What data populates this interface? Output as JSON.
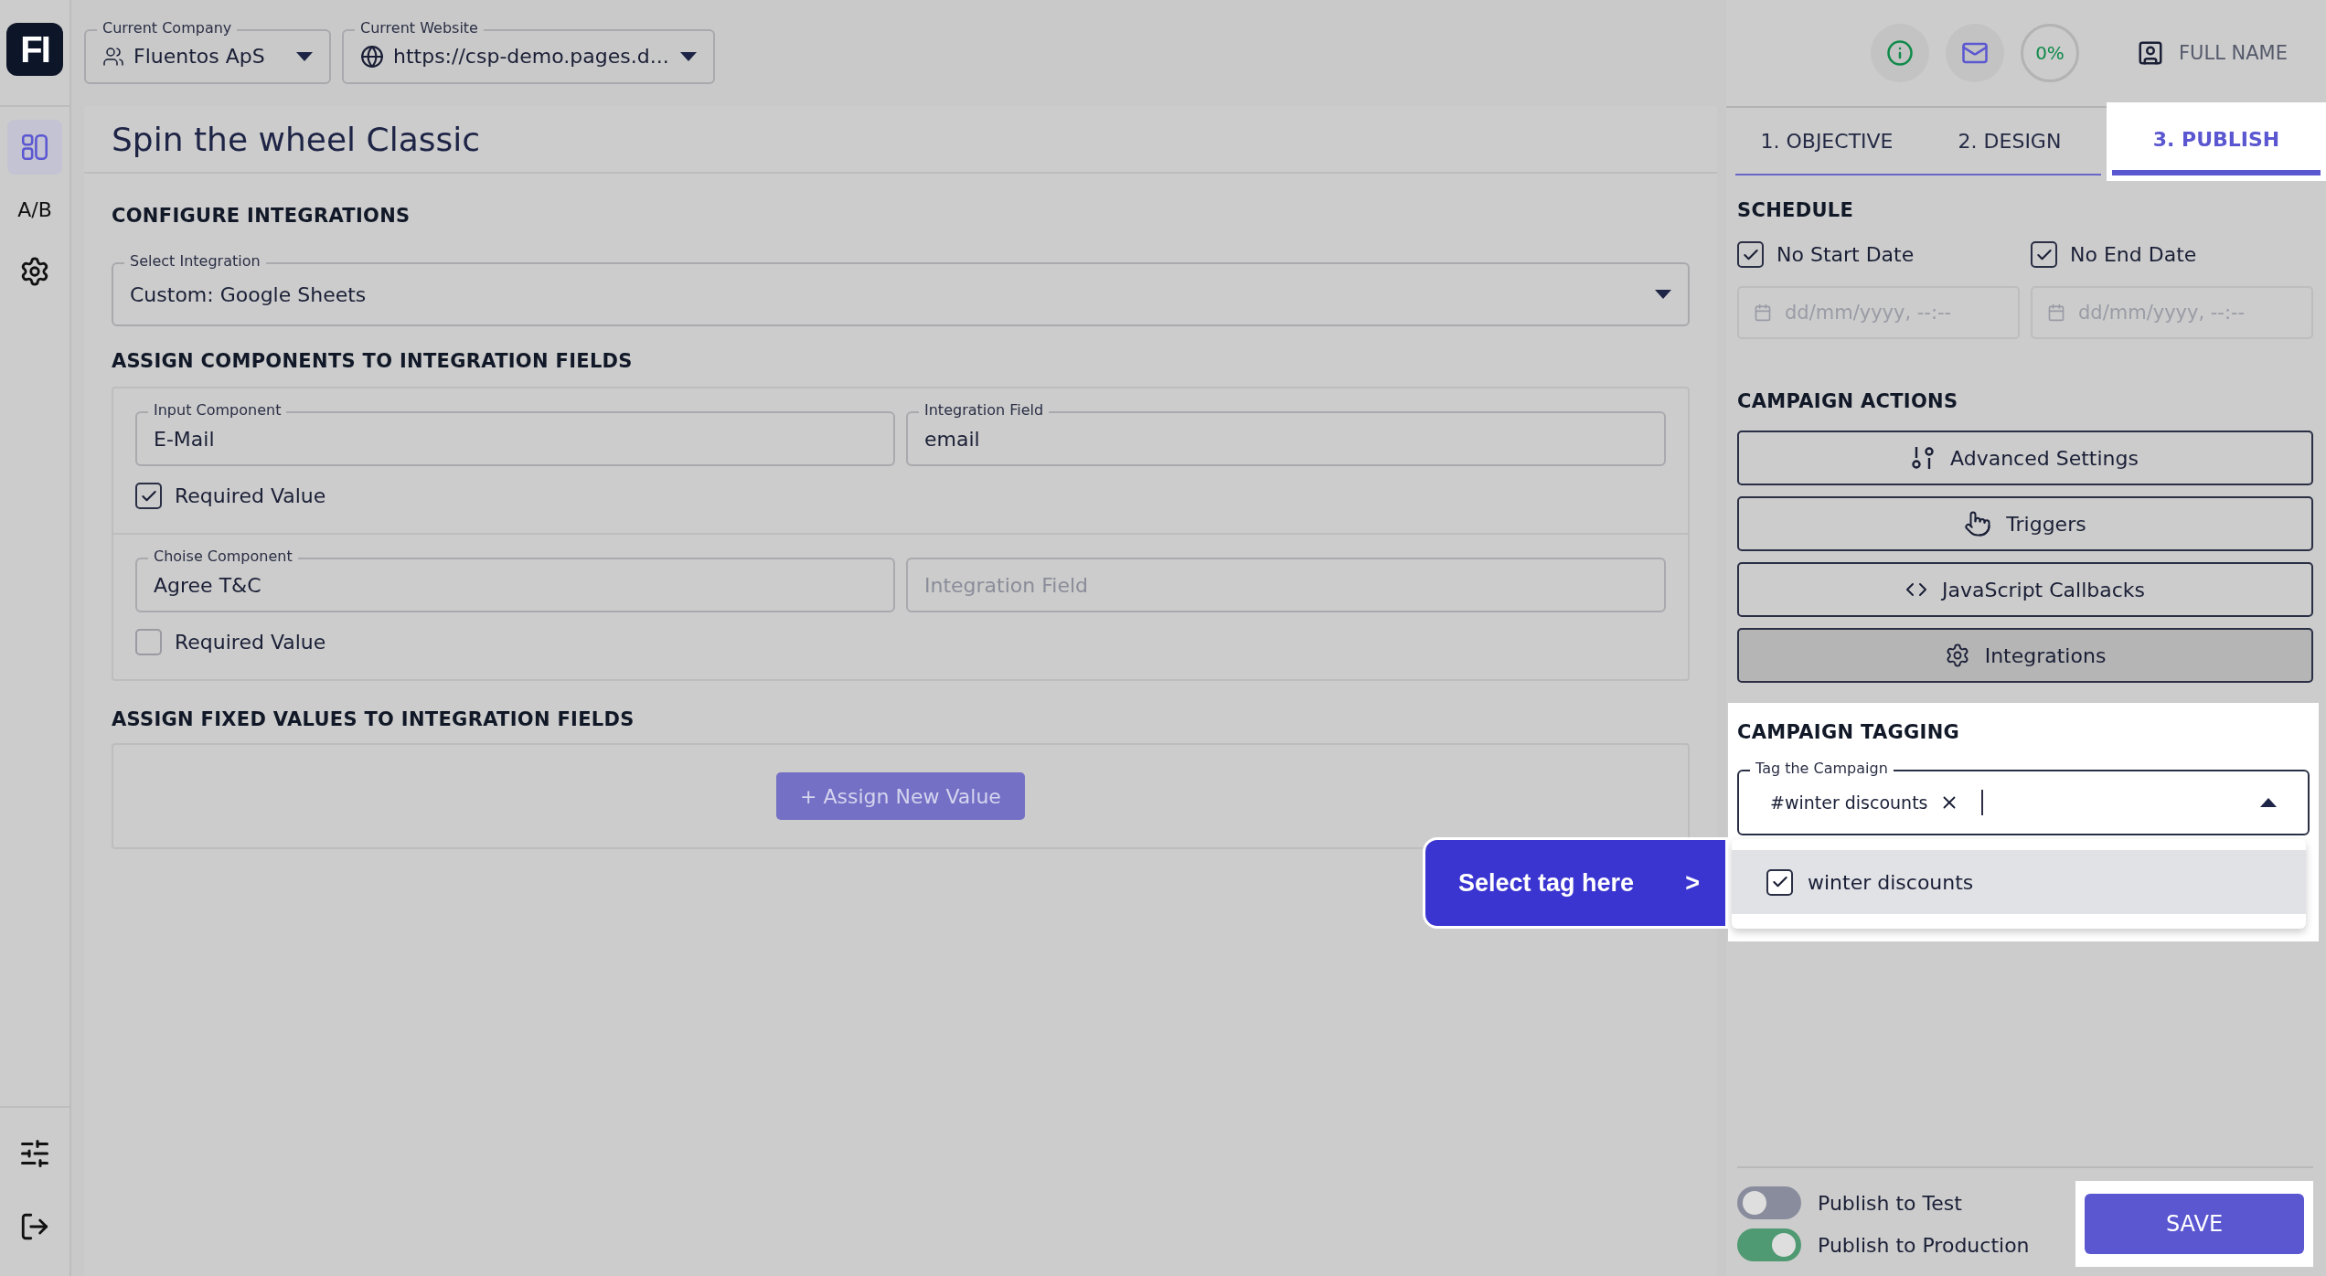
{
  "logo": "FI",
  "sidebar": {
    "items": [
      {
        "kind": "layout",
        "selected": true
      },
      {
        "kind": "text",
        "label": "A/B",
        "selected": false
      },
      {
        "kind": "settings",
        "selected": false
      }
    ],
    "bottom_items": [
      {
        "kind": "sliders"
      },
      {
        "kind": "logout"
      }
    ]
  },
  "header": {
    "company": {
      "label": "Current Company",
      "value": "Fluentos ApS"
    },
    "website": {
      "label": "Current Website",
      "value": "https://csp-demo.pages.d..."
    },
    "progress": "0%",
    "user": "FULL NAME"
  },
  "title": "Spin the wheel Classic",
  "integration": {
    "heading": "CONFIGURE INTEGRATIONS",
    "select": {
      "label": "Select Integration",
      "value": "Custom: Google Sheets"
    }
  },
  "assign": {
    "heading": "ASSIGN COMPONENTS TO INTEGRATION FIELDS",
    "rows": [
      {
        "component": {
          "label": "Input Component",
          "value": "E-Mail"
        },
        "field": {
          "label": "Integration Field",
          "value": "email"
        },
        "required": {
          "label": "Required Value",
          "checked": true
        }
      },
      {
        "component": {
          "label": "Choise Component",
          "value": "Agree T&C"
        },
        "field": {
          "placeholder": "Integration Field"
        },
        "required": {
          "label": "Required Value",
          "checked": false
        }
      }
    ]
  },
  "fixed": {
    "heading": "ASSIGN FIXED VALUES TO INTEGRATION FIELDS",
    "button": "+ Assign New Value"
  },
  "tabs": [
    {
      "label": "1. OBJECTIVE",
      "selected": false
    },
    {
      "label": "2. DESIGN",
      "selected": false
    },
    {
      "label": "3. PUBLISH",
      "selected": true
    }
  ],
  "schedule": {
    "heading": "SCHEDULE",
    "options": [
      {
        "label": "No Start Date",
        "checked": true,
        "placeholder": "dd/mm/yyyy, --:--"
      },
      {
        "label": "No End Date",
        "checked": true,
        "placeholder": "dd/mm/yyyy, --:--"
      }
    ]
  },
  "actions": {
    "heading": "CAMPAIGN ACTIONS",
    "buttons": [
      {
        "kind": "advanced",
        "label": "Advanced Settings",
        "selected": false
      },
      {
        "kind": "triggers",
        "label": "Triggers",
        "selected": false
      },
      {
        "kind": "code",
        "label": "JavaScript Callbacks",
        "selected": false
      },
      {
        "kind": "integrations",
        "label": "Integrations",
        "selected": true
      }
    ]
  },
  "tagging": {
    "heading": "CAMPAIGN TAGGING",
    "highlighted": true,
    "field": {
      "label": "Tag the Campaign",
      "tags": [
        "#winter discounts"
      ],
      "expanded": true
    },
    "options": [
      {
        "label": "winter discounts",
        "checked": true
      }
    ]
  },
  "publish": [
    {
      "label": "Publish to Test",
      "on": false
    },
    {
      "label": "Publish to Production",
      "on": true
    }
  ],
  "save": {
    "label": "SAVE",
    "highlighted": true
  },
  "tour": {
    "text": "Select tag here",
    "arrow": ">"
  }
}
